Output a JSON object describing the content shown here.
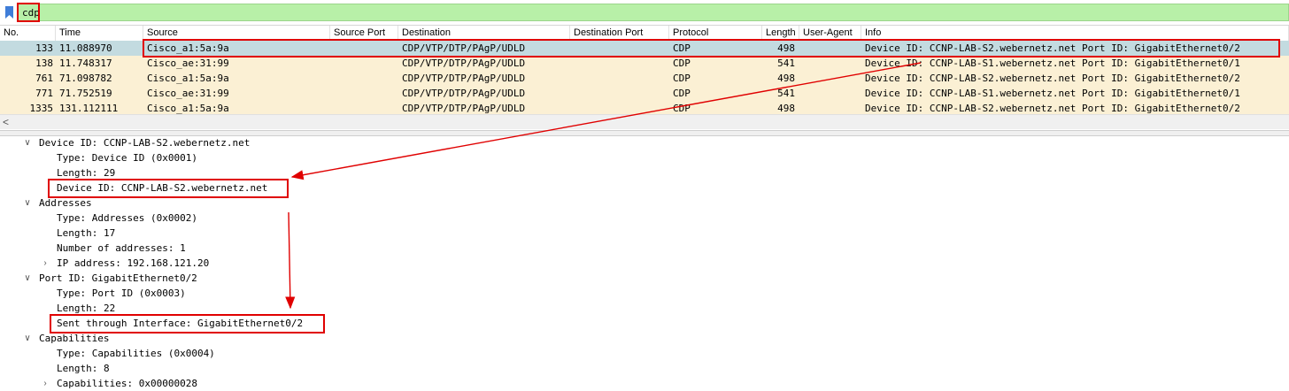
{
  "filter": {
    "value": "cdp"
  },
  "columns": [
    "No.",
    "Time",
    "Source",
    "Source Port",
    "Destination",
    "Destination Port",
    "Protocol",
    "Length",
    "User-Agent",
    "Info"
  ],
  "packets": [
    {
      "no": "133",
      "time": "11.088970",
      "src": "Cisco_a1:5a:9a",
      "sport": "",
      "dst": "CDP/VTP/DTP/PAgP/UDLD",
      "dport": "",
      "proto": "CDP",
      "len": "498",
      "ua": "",
      "info": "Device ID: CCNP-LAB-S2.webernetz.net  Port ID: GigabitEthernet0/2"
    },
    {
      "no": "138",
      "time": "11.748317",
      "src": "Cisco_ae:31:99",
      "sport": "",
      "dst": "CDP/VTP/DTP/PAgP/UDLD",
      "dport": "",
      "proto": "CDP",
      "len": "541",
      "ua": "",
      "info": "Device ID: CCNP-LAB-S1.webernetz.net  Port ID: GigabitEthernet0/1"
    },
    {
      "no": "761",
      "time": "71.098782",
      "src": "Cisco_a1:5a:9a",
      "sport": "",
      "dst": "CDP/VTP/DTP/PAgP/UDLD",
      "dport": "",
      "proto": "CDP",
      "len": "498",
      "ua": "",
      "info": "Device ID: CCNP-LAB-S2.webernetz.net  Port ID: GigabitEthernet0/2"
    },
    {
      "no": "771",
      "time": "71.752519",
      "src": "Cisco_ae:31:99",
      "sport": "",
      "dst": "CDP/VTP/DTP/PAgP/UDLD",
      "dport": "",
      "proto": "CDP",
      "len": "541",
      "ua": "",
      "info": "Device ID: CCNP-LAB-S1.webernetz.net  Port ID: GigabitEthernet0/1"
    },
    {
      "no": "1335",
      "time": "131.112111",
      "src": "Cisco_a1:5a:9a",
      "sport": "",
      "dst": "CDP/VTP/DTP/PAgP/UDLD",
      "dport": "",
      "proto": "CDP",
      "len": "498",
      "ua": "",
      "info": "Device ID: CCNP-LAB-S2.webernetz.net  Port ID: GigabitEthernet0/2"
    }
  ],
  "scroll_left_glyph": "<",
  "tree": [
    {
      "level": 0,
      "expander": "expanded",
      "text": "Device ID: CCNP-LAB-S2.webernetz.net"
    },
    {
      "level": 1,
      "expander": "none",
      "text": "Type: Device ID (0x0001)"
    },
    {
      "level": 1,
      "expander": "none",
      "text": "Length: 29"
    },
    {
      "level": 1,
      "expander": "none",
      "text": "Device ID: CCNP-LAB-S2.webernetz.net"
    },
    {
      "level": 0,
      "expander": "expanded",
      "text": "Addresses"
    },
    {
      "level": 1,
      "expander": "none",
      "text": "Type: Addresses (0x0002)"
    },
    {
      "level": 1,
      "expander": "none",
      "text": "Length: 17"
    },
    {
      "level": 1,
      "expander": "none",
      "text": "Number of addresses: 1"
    },
    {
      "level": 1,
      "expander": "collapsed",
      "text": "IP address: 192.168.121.20"
    },
    {
      "level": 0,
      "expander": "expanded",
      "text": "Port ID: GigabitEthernet0/2"
    },
    {
      "level": 1,
      "expander": "none",
      "text": "Type: Port ID (0x0003)"
    },
    {
      "level": 1,
      "expander": "none",
      "text": "Length: 22"
    },
    {
      "level": 1,
      "expander": "none",
      "text": "Sent through Interface: GigabitEthernet0/2"
    },
    {
      "level": 0,
      "expander": "expanded",
      "text": "Capabilities"
    },
    {
      "level": 1,
      "expander": "none",
      "text": "Type: Capabilities (0x0004)"
    },
    {
      "level": 1,
      "expander": "none",
      "text": "Length: 8"
    },
    {
      "level": 1,
      "expander": "collapsed",
      "text": "Capabilities: 0x00000028"
    }
  ],
  "icons": {
    "filter_bookmark": "bookmark-icon",
    "expanded": "chevron-down-icon",
    "collapsed": "chevron-right-icon"
  },
  "colors": {
    "filter_bg": "#b8f0a8",
    "row_bg": "#fbf0d4",
    "selected_bg": "#c3dbe0",
    "annotation": "#e00000"
  }
}
